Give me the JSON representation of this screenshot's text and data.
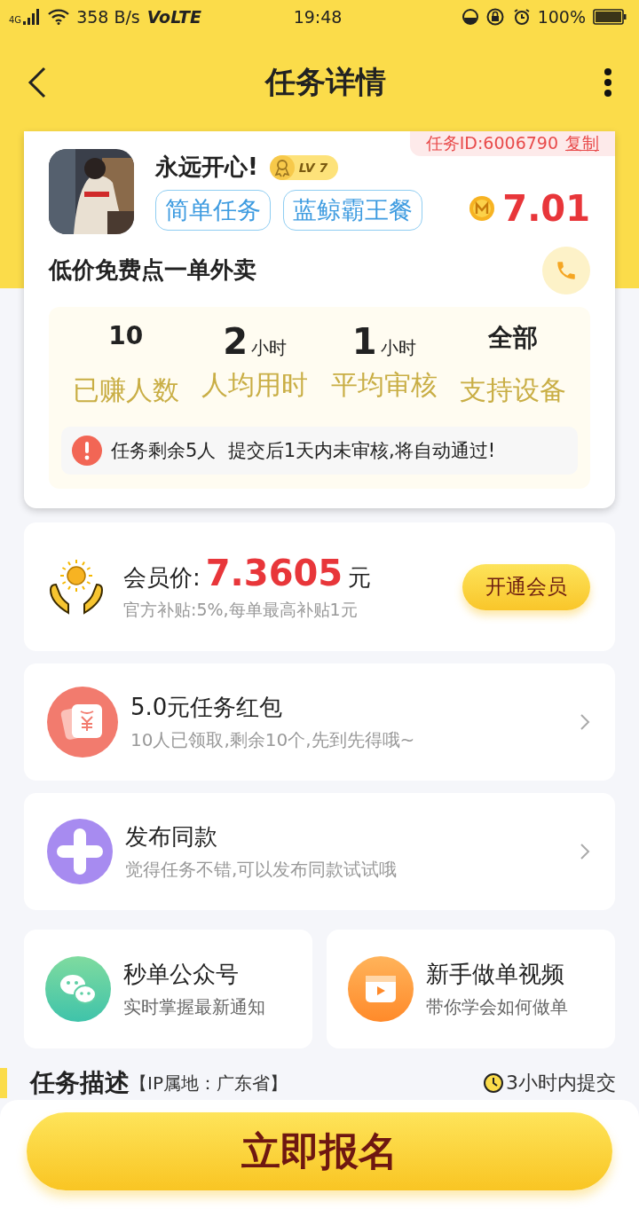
{
  "status_bar": {
    "network": "4G",
    "speed": "358 B/s",
    "volte": "VoLTE",
    "time": "19:48",
    "battery": "100%"
  },
  "nav": {
    "title": "任务详情"
  },
  "task": {
    "id_label": "任务ID:6006790",
    "copy": "复制",
    "user_name": "永远开心!",
    "level": "LV 7",
    "tags": [
      "简单任务",
      "蓝鲸霸王餐"
    ],
    "reward": "7.01",
    "title": "低价免费点一单外卖",
    "stats": [
      {
        "value": "10",
        "label": "已赚人数"
      },
      {
        "value": "2",
        "unit": "小时",
        "label": "人均用时"
      },
      {
        "value": "1",
        "unit": "小时",
        "label": "平均审核"
      },
      {
        "value": "全部",
        "label": "支持设备"
      }
    ],
    "notice": "任务剩余5人  提交后1天内未审核,将自动通过!"
  },
  "member": {
    "label": "会员价:",
    "price": "7.3605",
    "unit": "元",
    "note": "官方补贴:5%,每单最高补贴1元",
    "button": "开通会员"
  },
  "rows": [
    {
      "kind": "red_packet",
      "title": "5.0元任务红包",
      "subtitle": "10人已领取,剩余10个,先到先得哦~"
    },
    {
      "kind": "publish",
      "title": "发布同款",
      "subtitle": "觉得任务不错,可以发布同款试试哦"
    }
  ],
  "tiles": [
    {
      "kind": "wechat",
      "title": "秒单公众号",
      "subtitle": "实时掌握最新通知"
    },
    {
      "kind": "video",
      "title": "新手做单视频",
      "subtitle": "带你学会如何做单"
    }
  ],
  "section": {
    "title": "任务描述",
    "ip": "【IP属地：广东省】",
    "deadline": "3小时内提交"
  },
  "signup_button": "立即报名"
}
